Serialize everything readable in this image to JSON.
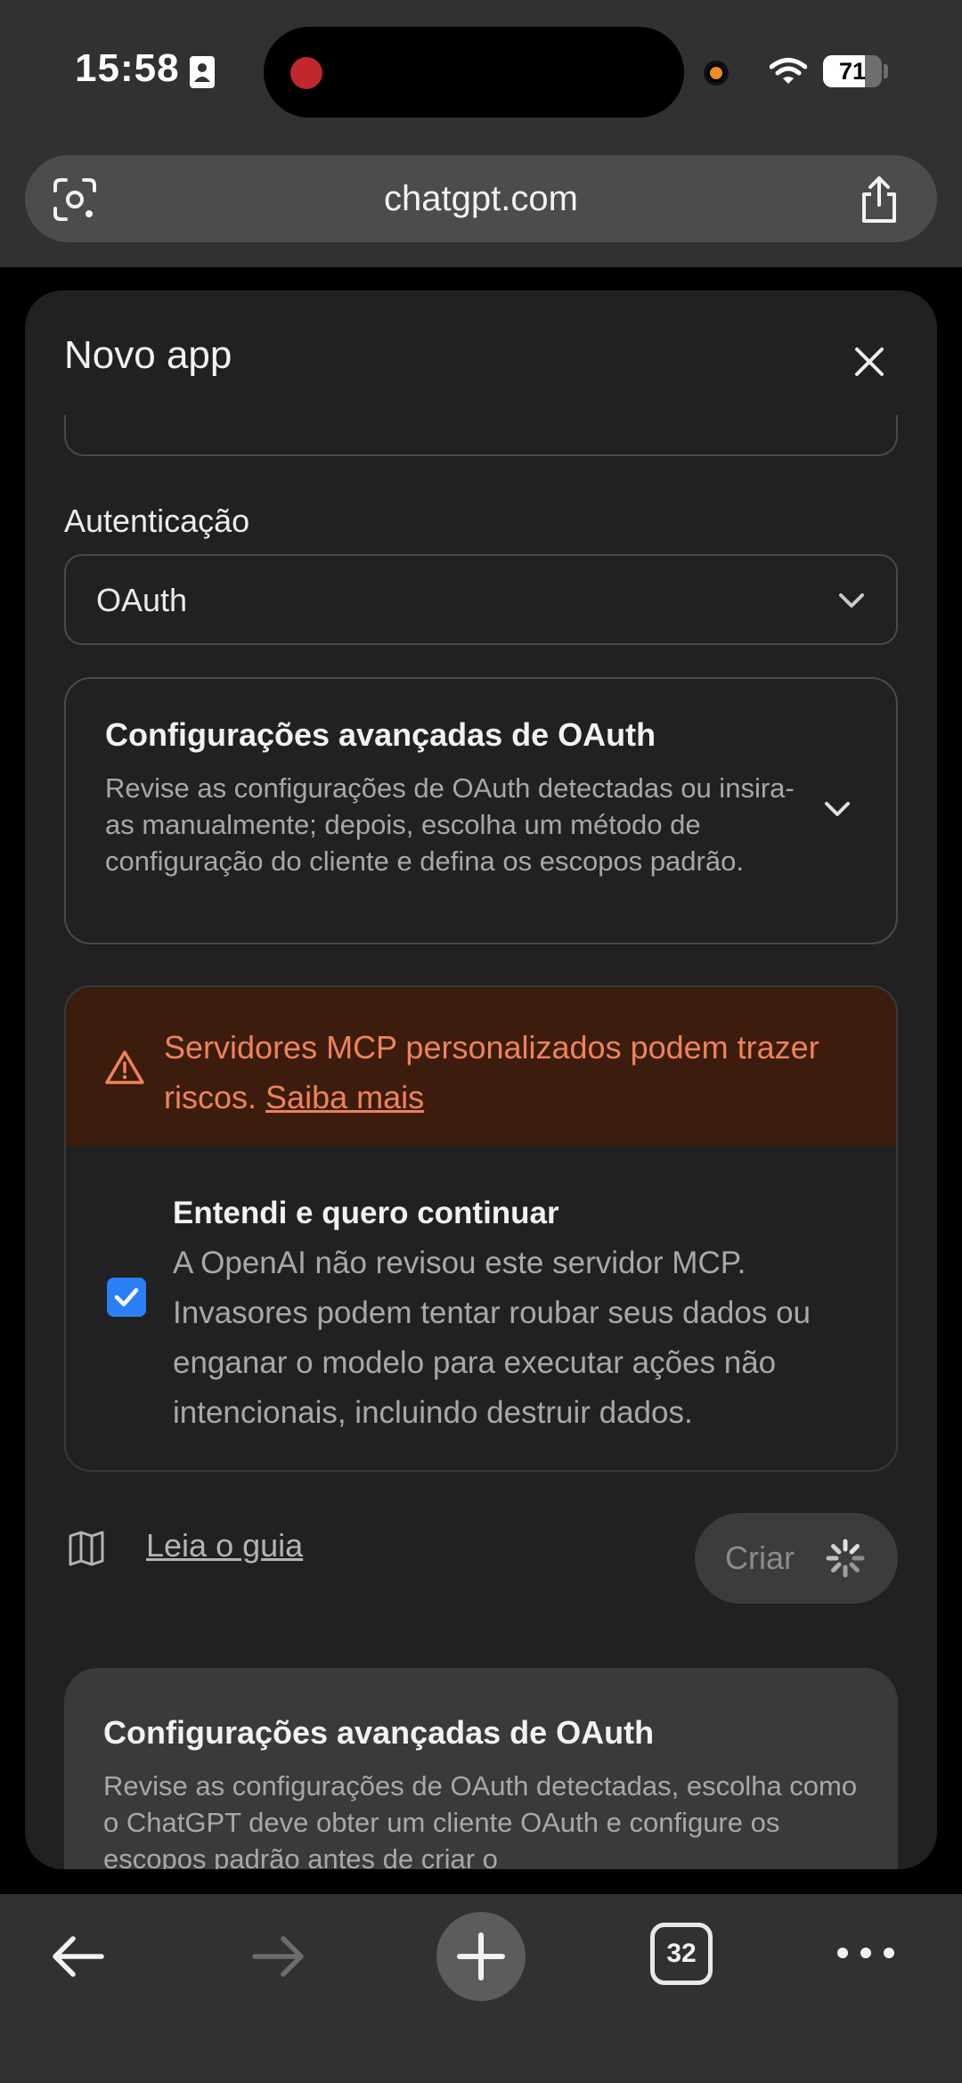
{
  "status": {
    "time": "15:58",
    "battery": "71",
    "battery_level": 0.71
  },
  "browser": {
    "url": "chatgpt.com",
    "tab_count": "32"
  },
  "modal": {
    "title": "Novo app",
    "auth_label": "Autenticação",
    "auth_value": "OAuth",
    "advanced": {
      "title": "Configurações avançadas de OAuth",
      "description": "Revise as configurações de OAuth detectadas ou insira-as manualmente; depois, escolha um método de configuração do cliente e defina os escopos padrão."
    },
    "warning": {
      "text": "Servidores MCP personalizados podem trazer riscos.",
      "link": "Saiba mais"
    },
    "acknowledge": {
      "title": "Entendi e quero continuar",
      "description": "A OpenAI não revisou este servidor MCP. Invasores podem tentar roubar seus dados ou enganar o modelo para executar ações não intencionais, incluindo destruir dados.",
      "checked": true
    },
    "guide_link": "Leia o guia",
    "create_label": "Criar"
  },
  "sheet": {
    "title": "Configurações avançadas de OAuth",
    "description": "Revise as configurações de OAuth detectadas, escolha como o ChatGPT deve obter um cliente OAuth e configure os escopos padrão antes de criar o"
  },
  "colors": {
    "modal_bg": "#212121",
    "warning_bg": "#3c1d0d",
    "warning_text": "#f0825a",
    "checkbox": "#2a7ff5",
    "record": "#c1272d"
  },
  "icons": [
    "id-card-icon",
    "wifi-icon",
    "lens-icon",
    "share-icon",
    "close-icon",
    "chevron-down-icon",
    "warning-icon",
    "check-icon",
    "book-icon",
    "spinner-icon",
    "back-icon",
    "forward-icon",
    "plus-icon",
    "more-icon"
  ]
}
